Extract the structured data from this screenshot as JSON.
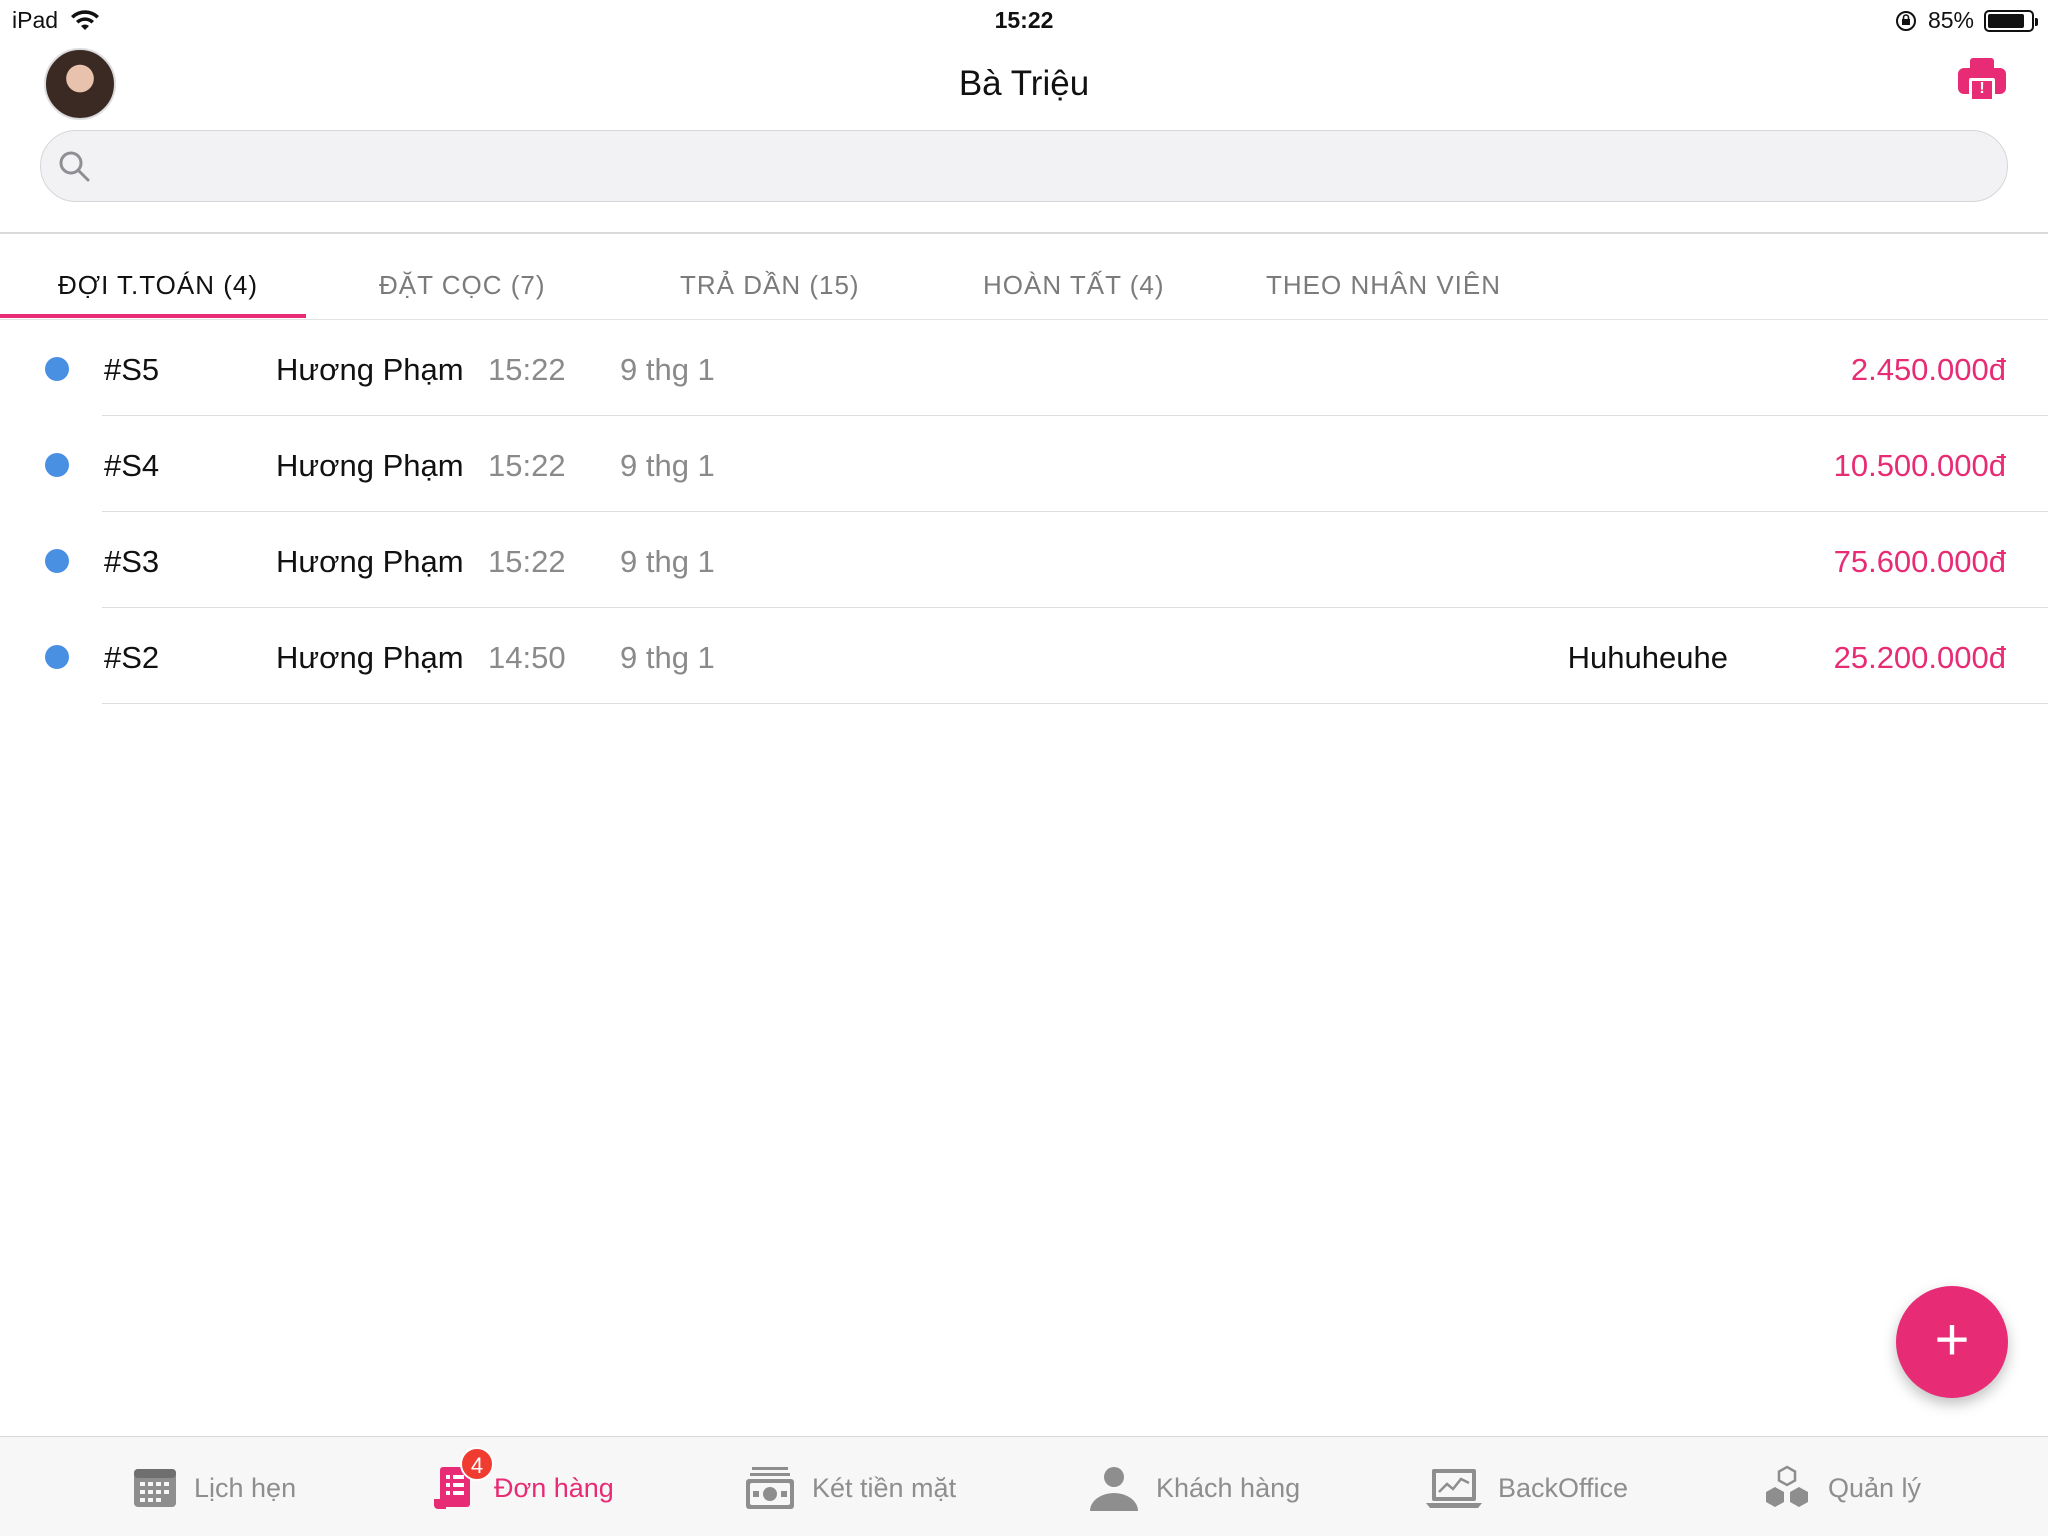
{
  "status_bar": {
    "device": "iPad",
    "time": "15:22",
    "battery": "85%",
    "battery_level": 0.85
  },
  "header": {
    "title": "Bà Triệu",
    "search_placeholder": ""
  },
  "tabs": [
    {
      "label": "ĐỢI T.TOÁN (4)",
      "active": true
    },
    {
      "label": "ĐẶT CỌC (7)",
      "active": false
    },
    {
      "label": "TRẢ DẦN (15)",
      "active": false
    },
    {
      "label": "HOÀN TẤT (4)",
      "active": false
    },
    {
      "label": "THEO NHÂN VIÊN",
      "active": false
    }
  ],
  "orders": [
    {
      "id": "#S5",
      "name": "Hương Phạm",
      "time": "15:22",
      "date": "9 thg 1",
      "note": "",
      "amount": "2.450.000đ"
    },
    {
      "id": "#S4",
      "name": "Hương Phạm",
      "time": "15:22",
      "date": "9 thg 1",
      "note": "",
      "amount": "10.500.000đ"
    },
    {
      "id": "#S3",
      "name": "Hương Phạm",
      "time": "15:22",
      "date": "9 thg 1",
      "note": "",
      "amount": "75.600.000đ"
    },
    {
      "id": "#S2",
      "name": "Hương Phạm",
      "time": "14:50",
      "date": "9 thg 1",
      "note": "Huhuheuhe",
      "amount": "25.200.000đ"
    }
  ],
  "fab": {
    "label": "+"
  },
  "tabbar": {
    "items": [
      {
        "label": "Lịch hẹn",
        "icon": "calendar-icon"
      },
      {
        "label": "Đơn hàng",
        "icon": "receipt-icon",
        "badge": "4",
        "active": true
      },
      {
        "label": "Két tiền mặt",
        "icon": "cash-register-icon"
      },
      {
        "label": "Khách hàng",
        "icon": "person-icon"
      },
      {
        "label": "BackOffice",
        "icon": "laptop-chart-icon"
      },
      {
        "label": "Quản lý",
        "icon": "cubes-icon"
      }
    ]
  },
  "colors": {
    "accent": "#e72b74",
    "dot": "#4a90e2",
    "badge": "#f03b30"
  }
}
